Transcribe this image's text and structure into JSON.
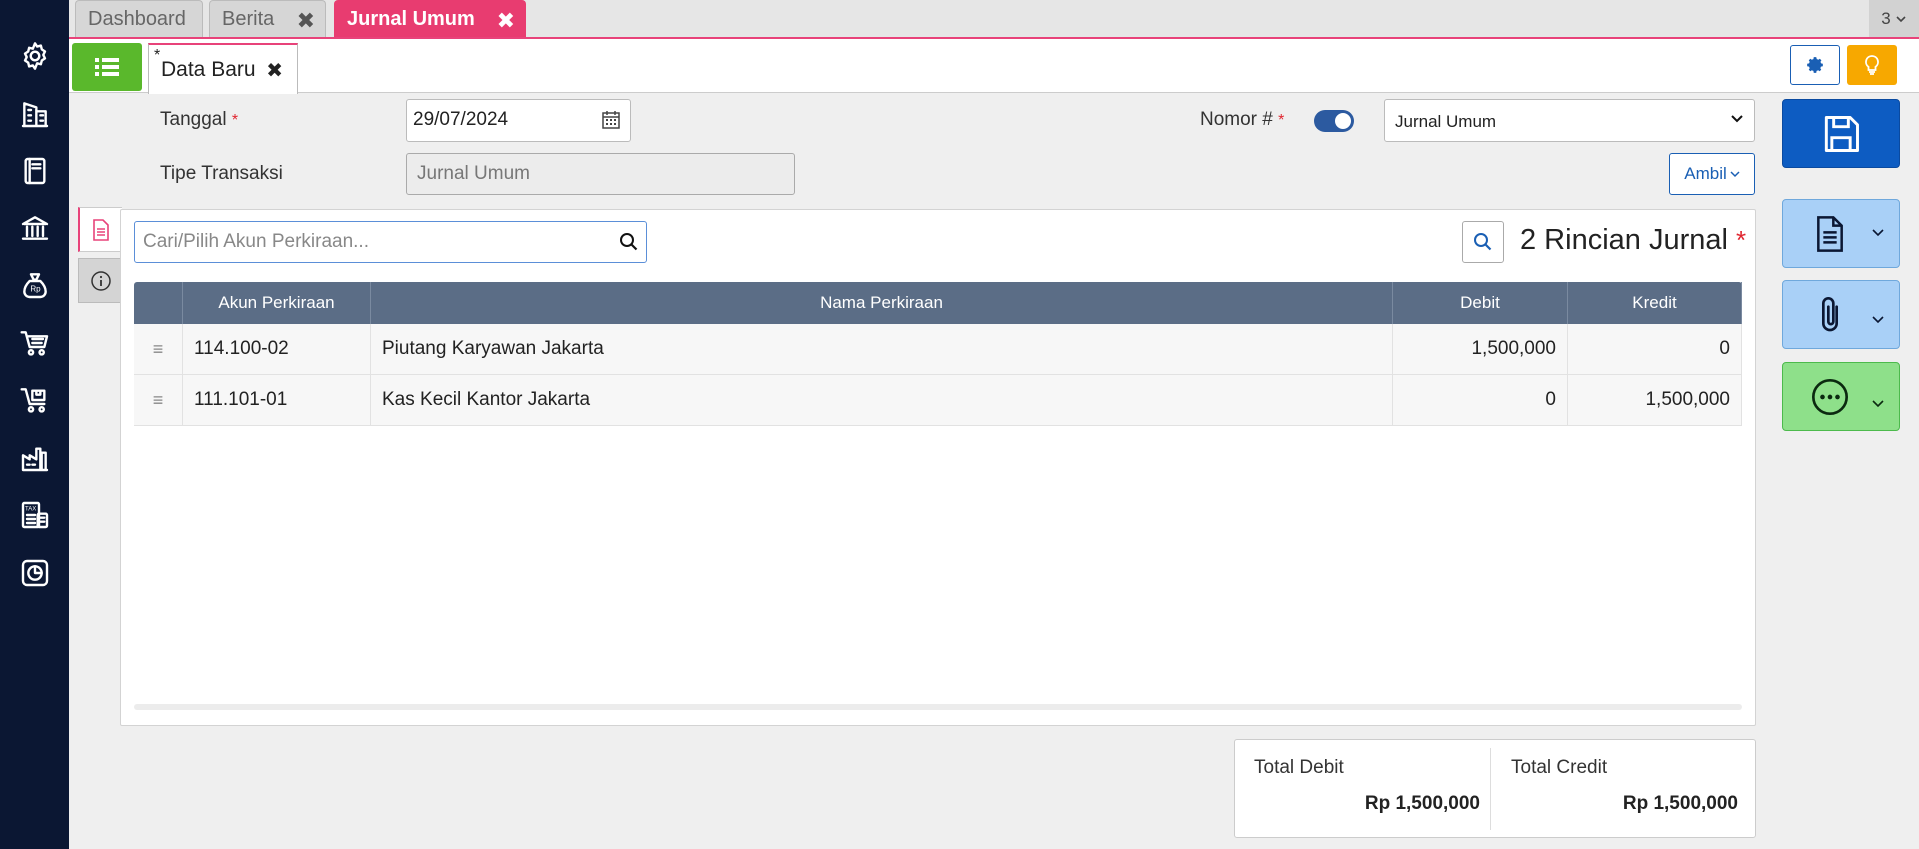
{
  "tabs": [
    {
      "label": "Dashboard"
    },
    {
      "label": "Berita"
    },
    {
      "label": "Jurnal Umum"
    }
  ],
  "tab_overflow": {
    "count": "3"
  },
  "subtab": {
    "label": "Data Baru",
    "modified_marker": "*"
  },
  "form": {
    "tanggal_label": "Tanggal",
    "tanggal_value": "29/07/2024",
    "tipe_label": "Tipe Transaksi",
    "tipe_value": "Jurnal Umum",
    "nomor_label": "Nomor #",
    "nomor_select": "Jurnal Umum",
    "ambil_label": "Ambil",
    "required_mark": "*"
  },
  "detail": {
    "search_placeholder": "Cari/Pilih Akun Perkiraan...",
    "title": "2 Rincian Jurnal",
    "columns": [
      "Akun Perkiraan",
      "Nama Perkiraan",
      "Debit",
      "Kredit"
    ],
    "rows": [
      {
        "akun": "114.100-02",
        "nama": "Piutang Karyawan Jakarta",
        "debit": "1,500,000",
        "kredit": "0"
      },
      {
        "akun": "111.101-01",
        "nama": "Kas Kecil Kantor Jakarta",
        "debit": "0",
        "kredit": "1,500,000"
      }
    ]
  },
  "totals": {
    "debit_label": "Total Debit",
    "debit_value": "Rp 1,500,000",
    "credit_label": "Total Credit",
    "credit_value": "Rp 1,500,000"
  },
  "colors": {
    "sidebar": "#0b1733",
    "active_tab": "#e83c70",
    "list_button": "#5ab82c",
    "save_button": "#0d5cc2",
    "doc_button": "#a9d0f7",
    "more_button": "#8ee08a",
    "bulb_button": "#f7a800",
    "grid_header": "#5b6d86"
  },
  "sidebar_icons": [
    "gear-icon",
    "building-icon",
    "book-icon",
    "bank-icon",
    "money-bag-icon",
    "cart-icon",
    "cart-box-icon",
    "factory-icon",
    "tax-icon",
    "report-icon"
  ]
}
